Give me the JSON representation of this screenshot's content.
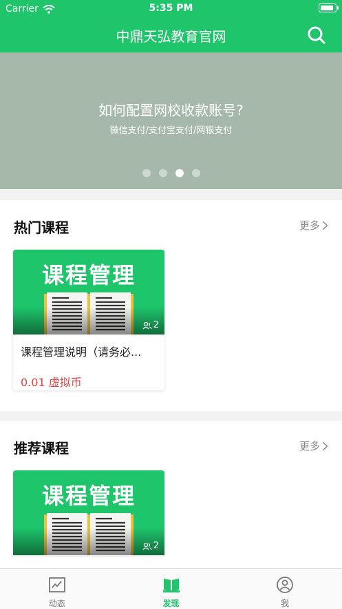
{
  "status_bar": {
    "carrier": "Carrier",
    "time": "5:35 PM"
  },
  "header": {
    "title": "中鼎天弘教育官网",
    "search_icon": "search-icon"
  },
  "banner": {
    "title": "如何配置网校收款账号?",
    "subtitle": "微信支付/支付宝支付/网银支付",
    "slide_count": 4,
    "active_index": 2
  },
  "sections": {
    "hot": {
      "title": "热门课程",
      "more_label": "更多",
      "courses": [
        {
          "thumb_title": "课程管理",
          "students": "2",
          "name": "课程管理说明（请务必...",
          "price": "0.01 虚拟币"
        }
      ]
    },
    "recommended": {
      "title": "推荐课程",
      "more_label": "更多",
      "courses": [
        {
          "thumb_title": "课程管理",
          "students": "2"
        }
      ]
    }
  },
  "tabbar": {
    "items": [
      {
        "label": "动态",
        "icon": "chart-icon"
      },
      {
        "label": "发现",
        "icon": "book-icon",
        "active": true
      },
      {
        "label": "我",
        "icon": "user-icon"
      }
    ]
  },
  "colors": {
    "brand": "#1ec56b",
    "banner_bg": "#a5b8aa",
    "price": "#e64340"
  }
}
